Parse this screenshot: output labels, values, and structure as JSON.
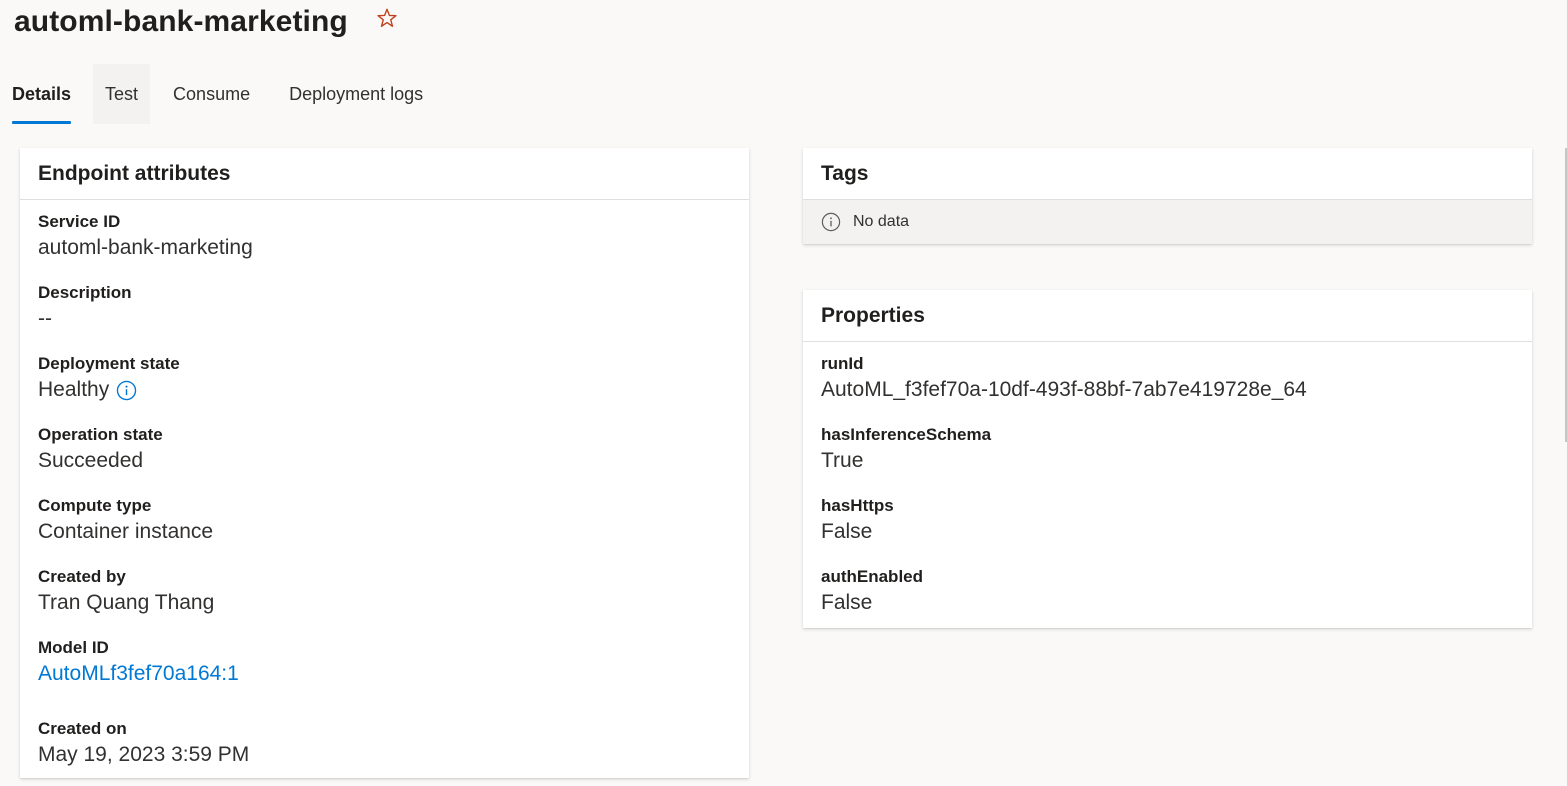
{
  "header": {
    "title": "automl-bank-marketing",
    "star_icon": "star-outline-icon",
    "star_color": "#c0401b"
  },
  "tabs": [
    {
      "label": "Details",
      "active": true
    },
    {
      "label": "Test",
      "active": false
    },
    {
      "label": "Consume",
      "active": false
    },
    {
      "label": "Deployment logs",
      "active": false
    }
  ],
  "endpoint": {
    "title": "Endpoint attributes",
    "service_id": {
      "label": "Service ID",
      "value": "automl-bank-marketing"
    },
    "description": {
      "label": "Description",
      "value": "--"
    },
    "deployment_state": {
      "label": "Deployment state",
      "value": "Healthy"
    },
    "operation_state": {
      "label": "Operation state",
      "value": "Succeeded"
    },
    "compute_type": {
      "label": "Compute type",
      "value": "Container instance"
    },
    "created_by": {
      "label": "Created by",
      "value": "Tran Quang Thang"
    },
    "model_id": {
      "label": "Model ID",
      "value": "AutoMLf3fef70a164:1"
    },
    "created_on": {
      "label": "Created on",
      "value": "May 19, 2023 3:59 PM"
    }
  },
  "tags": {
    "title": "Tags",
    "empty_text": "No data"
  },
  "properties": {
    "title": "Properties",
    "items": [
      {
        "label": "runId",
        "value": "AutoML_f3fef70a-10df-493f-88bf-7ab7e419728e_64"
      },
      {
        "label": "hasInferenceSchema",
        "value": "True"
      },
      {
        "label": "hasHttps",
        "value": "False"
      },
      {
        "label": "authEnabled",
        "value": "False"
      }
    ]
  },
  "colors": {
    "accent": "#0078d4",
    "background": "#faf9f8",
    "card": "#ffffff"
  }
}
